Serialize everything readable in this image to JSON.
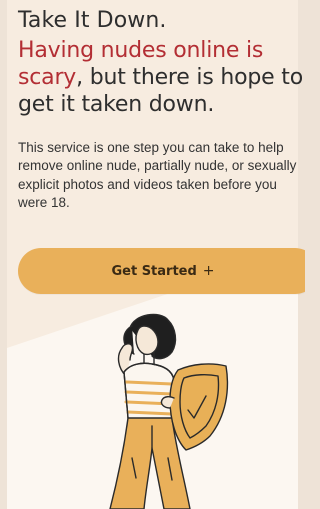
{
  "brand": "Take It Down.",
  "headline": {
    "accent": "Having nudes online is scary",
    "rest": ", but there is hope to get it taken down."
  },
  "description": "This service is one step you can take to help remove online nude, partially nude, or sexually explicit photos and videos taken before you were 18.",
  "cta": {
    "label": "Get Started",
    "icon_glyph": "+",
    "icon": "plus-icon"
  },
  "illustration": "person-with-shield",
  "colors": {
    "accent_red": "#b32e34",
    "button": "#e9b05a",
    "background_top": "#f7efe6",
    "background_bottom": "#fbf6ef"
  }
}
